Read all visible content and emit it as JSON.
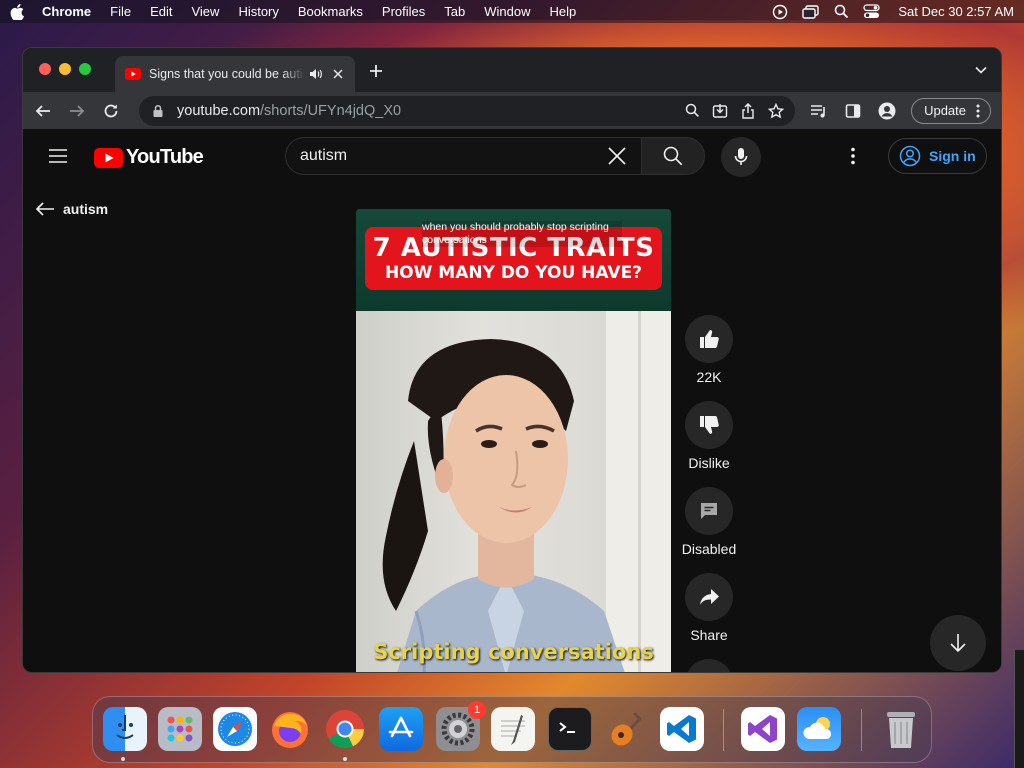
{
  "menubar": {
    "app_name": "Chrome",
    "items": [
      "File",
      "Edit",
      "View",
      "History",
      "Bookmarks",
      "Profiles",
      "Tab",
      "Window",
      "Help"
    ],
    "datetime": "Sat Dec 30  2:57 AM"
  },
  "browser": {
    "tab_title": "Signs that you could be autistic",
    "url_host": "youtube.com",
    "url_path": "/shorts/UFYn4jdQ_X0",
    "update_label": "Update"
  },
  "youtube": {
    "logo_text": "YouTube",
    "search_value": "autism",
    "sign_in_label": "Sign in",
    "back_label": "autism",
    "short": {
      "top_caption": "when you should probably stop scripting conversations",
      "banner_line1": "7 AUTISTIC TRAITS",
      "banner_line2": "HOW MANY DO YOU HAVE?",
      "bottom_caption": "Scripting conversations"
    },
    "actions": {
      "like_count": "22K",
      "dislike_label": "Dislike",
      "comments_label": "Disabled",
      "share_label": "Share"
    }
  },
  "dock": {
    "apps": [
      "Finder",
      "Launchpad",
      "Safari",
      "Firefox",
      "Chrome",
      "App Store",
      "System Preferences",
      "TextEdit",
      "Terminal",
      "GarageBand",
      "Visual Studio Code",
      "Visual Studio",
      "Weather",
      "Trash"
    ],
    "settings_badge": "1"
  }
}
